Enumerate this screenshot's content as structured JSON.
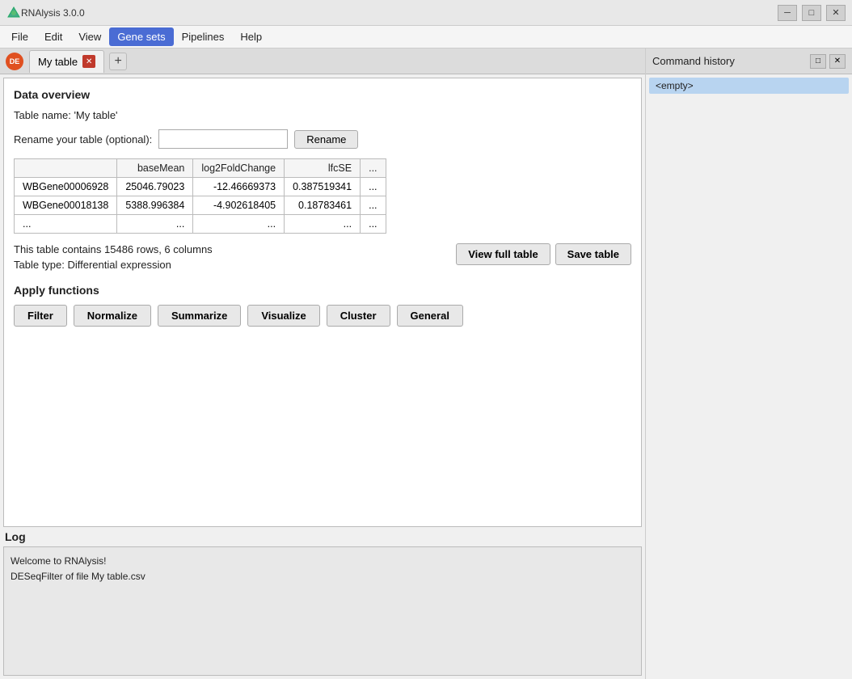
{
  "titleBar": {
    "title": "RNAlysis 3.0.0",
    "minimize": "─",
    "maximize": "□",
    "close": "✕"
  },
  "menuBar": {
    "items": [
      {
        "label": "File",
        "active": false
      },
      {
        "label": "Edit",
        "active": false
      },
      {
        "label": "View",
        "active": false
      },
      {
        "label": "Gene sets",
        "active": true
      },
      {
        "label": "Pipelines",
        "active": false
      },
      {
        "label": "Help",
        "active": false
      }
    ]
  },
  "tabBar": {
    "tabLabel": "My table",
    "addBtn": "+",
    "closeBtn": "✕"
  },
  "dataOverview": {
    "sectionTitle": "Data overview",
    "tableNameLabel": "Table name: ",
    "tableNameValue": "'My table'",
    "renameLabel": "Rename your table (optional):",
    "renamePlaceholder": "",
    "renameBtn": "Rename",
    "tableColumns": [
      "",
      "baseMean",
      "log2FoldChange",
      "lfcSE",
      "..."
    ],
    "tableRows": [
      [
        "WBGene00006928",
        "25046.79023",
        "-12.46669373",
        "0.387519341",
        "..."
      ],
      [
        "WBGene00018138",
        "5388.996384",
        "-4.902618405",
        "0.18783461",
        "..."
      ],
      [
        "...",
        "...",
        "...",
        "...",
        "..."
      ]
    ],
    "statsLine1": "This table contains 15486 rows, 6 columns",
    "statsLine2": "Table type: Differential expression",
    "viewFullTableBtn": "View full table",
    "saveTableBtn": "Save table"
  },
  "applyFunctions": {
    "sectionTitle": "Apply functions",
    "buttons": [
      {
        "label": "Filter"
      },
      {
        "label": "Normalize"
      },
      {
        "label": "Summarize"
      },
      {
        "label": "Visualize"
      },
      {
        "label": "Cluster"
      },
      {
        "label": "General"
      }
    ]
  },
  "log": {
    "title": "Log",
    "lines": [
      "Welcome to RNAlysis!",
      "DESeqFilter of file My table.csv"
    ]
  },
  "commandHistory": {
    "title": "Command history",
    "emptyLabel": "<empty>",
    "pinBtn": "□",
    "closeBtn": "✕"
  }
}
